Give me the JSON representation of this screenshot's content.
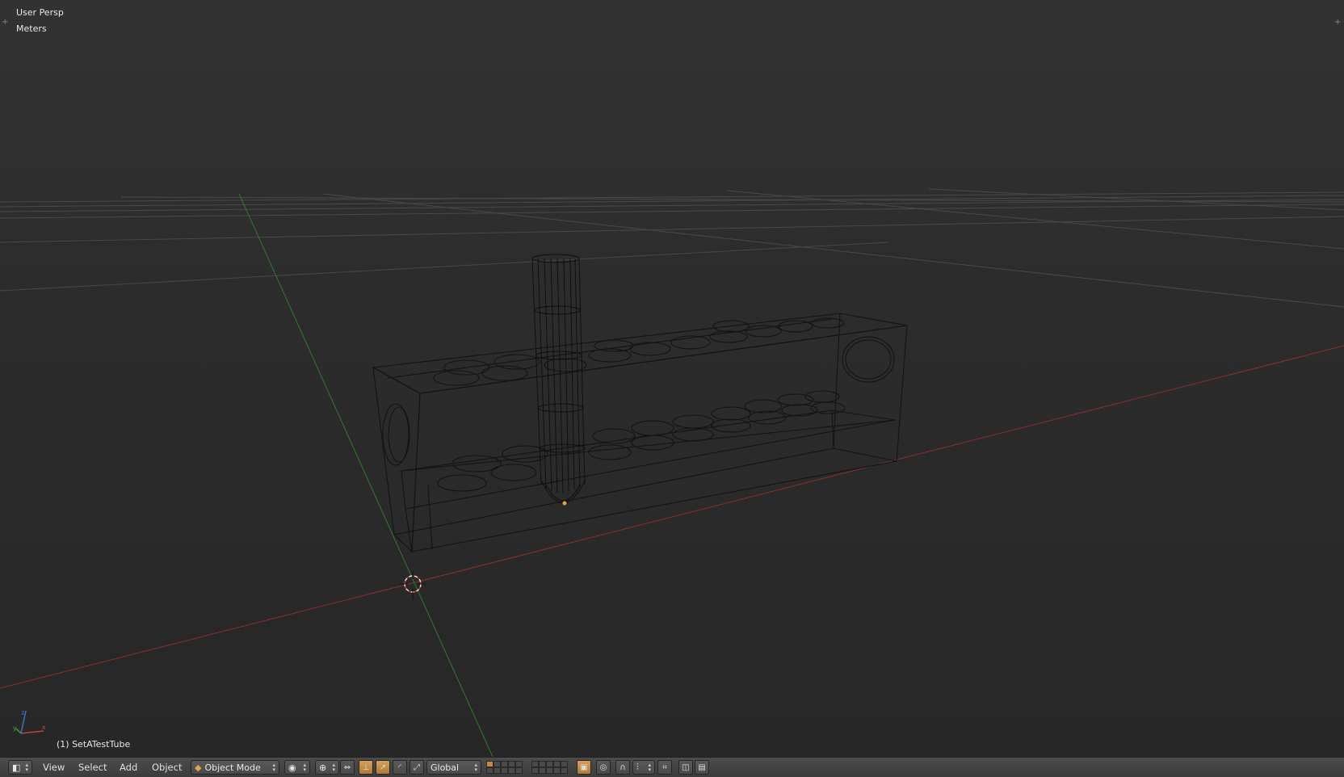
{
  "viewport": {
    "view_name": "User Persp",
    "units": "Meters",
    "active_object": "(1) SetATestTube",
    "axis_x_color": "#b03434",
    "axis_y_color": "#3c9a3c",
    "axis_gizmo": {
      "x": "x",
      "y": "y",
      "z": "z"
    },
    "background_color": "#2d2d2d"
  },
  "header": {
    "editor_type_icon": "3d-view-icon",
    "menus": {
      "view": "View",
      "select": "Select",
      "add": "Add",
      "object": "Object"
    },
    "mode": "Object Mode",
    "orientation": "Global",
    "accent_color": "#c28a44"
  }
}
